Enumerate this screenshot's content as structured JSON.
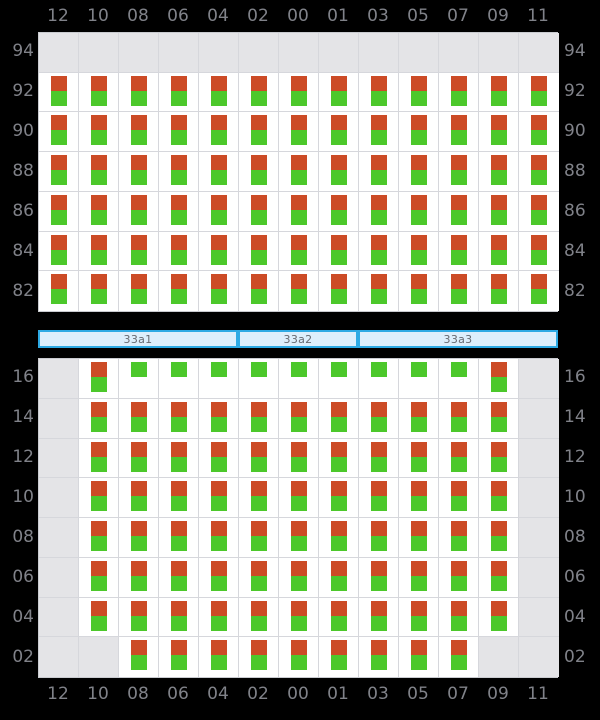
{
  "columns": [
    "12",
    "10",
    "08",
    "06",
    "04",
    "02",
    "00",
    "01",
    "03",
    "05",
    "07",
    "09",
    "11"
  ],
  "colors": {
    "red": "#cc4b26",
    "green": "#4cc82b",
    "empty_cell": "#e4e4e7",
    "cell": "#ffffff",
    "grid_line": "#d6d7dc",
    "band_fill": "#ddeffc",
    "band_border": "#2eaae4",
    "label": "#808289",
    "background": "#000000"
  },
  "top_panel": {
    "row_labels": [
      "94",
      "92",
      "90",
      "88",
      "86",
      "84",
      "82"
    ],
    "rows": [
      {
        "label": "94",
        "cells": [
          "empty",
          "empty",
          "empty",
          "empty",
          "empty",
          "empty",
          "empty",
          "empty",
          "empty",
          "empty",
          "empty",
          "empty",
          "empty"
        ]
      },
      {
        "label": "92",
        "cells": [
          "rg",
          "rg",
          "rg",
          "rg",
          "rg",
          "rg",
          "rg",
          "rg",
          "rg",
          "rg",
          "rg",
          "rg",
          "rg"
        ]
      },
      {
        "label": "90",
        "cells": [
          "rg",
          "rg",
          "rg",
          "rg",
          "rg",
          "rg",
          "rg",
          "rg",
          "rg",
          "rg",
          "rg",
          "rg",
          "rg"
        ]
      },
      {
        "label": "88",
        "cells": [
          "rg",
          "rg",
          "rg",
          "rg",
          "rg",
          "rg",
          "rg",
          "rg",
          "rg",
          "rg",
          "rg",
          "rg",
          "rg"
        ]
      },
      {
        "label": "86",
        "cells": [
          "rg",
          "rg",
          "rg",
          "rg",
          "rg",
          "rg",
          "rg",
          "rg",
          "rg",
          "rg",
          "rg",
          "rg",
          "rg"
        ]
      },
      {
        "label": "84",
        "cells": [
          "rg",
          "rg",
          "rg",
          "rg",
          "rg",
          "rg",
          "rg",
          "rg",
          "rg",
          "rg",
          "rg",
          "rg",
          "rg"
        ]
      },
      {
        "label": "82",
        "cells": [
          "rg",
          "rg",
          "rg",
          "rg",
          "rg",
          "rg",
          "rg",
          "rg",
          "rg",
          "rg",
          "rg",
          "rg",
          "rg"
        ]
      }
    ]
  },
  "band": {
    "segments": [
      {
        "label": "33a1",
        "span": 5
      },
      {
        "label": "33a2",
        "span": 3
      },
      {
        "label": "33a3",
        "span": 5
      }
    ]
  },
  "bottom_panel": {
    "row_labels": [
      "16",
      "14",
      "12",
      "10",
      "08",
      "06",
      "04",
      "02"
    ],
    "rows": [
      {
        "label": "16",
        "cells": [
          "empty",
          "rg",
          "g",
          "g",
          "g",
          "g",
          "g",
          "g",
          "g",
          "g",
          "g",
          "rg",
          "empty"
        ]
      },
      {
        "label": "14",
        "cells": [
          "empty",
          "rg",
          "rg",
          "rg",
          "rg",
          "rg",
          "rg",
          "rg",
          "rg",
          "rg",
          "rg",
          "rg",
          "empty"
        ]
      },
      {
        "label": "12",
        "cells": [
          "empty",
          "rg",
          "rg",
          "rg",
          "rg",
          "rg",
          "rg",
          "rg",
          "rg",
          "rg",
          "rg",
          "rg",
          "empty"
        ]
      },
      {
        "label": "10",
        "cells": [
          "empty",
          "rg",
          "rg",
          "rg",
          "rg",
          "rg",
          "rg",
          "rg",
          "rg",
          "rg",
          "rg",
          "rg",
          "empty"
        ]
      },
      {
        "label": "08",
        "cells": [
          "empty",
          "rg",
          "rg",
          "rg",
          "rg",
          "rg",
          "rg",
          "rg",
          "rg",
          "rg",
          "rg",
          "rg",
          "empty"
        ]
      },
      {
        "label": "06",
        "cells": [
          "empty",
          "rg",
          "rg",
          "rg",
          "rg",
          "rg",
          "rg",
          "rg",
          "rg",
          "rg",
          "rg",
          "rg",
          "empty"
        ]
      },
      {
        "label": "04",
        "cells": [
          "empty",
          "rg",
          "rg",
          "rg",
          "rg",
          "rg",
          "rg",
          "rg",
          "rg",
          "rg",
          "rg",
          "rg",
          "empty"
        ]
      },
      {
        "label": "02",
        "cells": [
          "empty",
          "empty",
          "rg",
          "rg",
          "rg",
          "rg",
          "rg",
          "rg",
          "rg",
          "rg",
          "rg",
          "empty",
          "empty"
        ]
      }
    ]
  },
  "chart_data": {
    "type": "heatmap",
    "title": "",
    "xlabel": "",
    "ylabel": "",
    "x_tick_labels": [
      "12",
      "10",
      "08",
      "06",
      "04",
      "02",
      "00",
      "01",
      "03",
      "05",
      "07",
      "09",
      "11"
    ],
    "panels": [
      {
        "name": "top",
        "y_tick_labels": [
          "94",
          "92",
          "90",
          "88",
          "86",
          "84",
          "82"
        ],
        "marker_types": [
          "red",
          "green"
        ],
        "matrix": [
          [
            "",
            "",
            "",
            "",
            "",
            "",
            "",
            "",
            "",
            "",
            "",
            "",
            ""
          ],
          [
            "rg",
            "rg",
            "rg",
            "rg",
            "rg",
            "rg",
            "rg",
            "rg",
            "rg",
            "rg",
            "rg",
            "rg",
            "rg"
          ],
          [
            "rg",
            "rg",
            "rg",
            "rg",
            "rg",
            "rg",
            "rg",
            "rg",
            "rg",
            "rg",
            "rg",
            "rg",
            "rg"
          ],
          [
            "rg",
            "rg",
            "rg",
            "rg",
            "rg",
            "rg",
            "rg",
            "rg",
            "rg",
            "rg",
            "rg",
            "rg",
            "rg"
          ],
          [
            "rg",
            "rg",
            "rg",
            "rg",
            "rg",
            "rg",
            "rg",
            "rg",
            "rg",
            "rg",
            "rg",
            "rg",
            "rg"
          ],
          [
            "rg",
            "rg",
            "rg",
            "rg",
            "rg",
            "rg",
            "rg",
            "rg",
            "rg",
            "rg",
            "rg",
            "rg",
            "rg"
          ],
          [
            "rg",
            "rg",
            "rg",
            "rg",
            "rg",
            "rg",
            "rg",
            "rg",
            "rg",
            "rg",
            "rg",
            "rg",
            "rg"
          ]
        ]
      },
      {
        "name": "bottom",
        "y_tick_labels": [
          "16",
          "14",
          "12",
          "10",
          "08",
          "06",
          "04",
          "02"
        ],
        "marker_types": [
          "red",
          "green"
        ],
        "matrix": [
          [
            "",
            "rg",
            "g",
            "g",
            "g",
            "g",
            "g",
            "g",
            "g",
            "g",
            "g",
            "rg",
            ""
          ],
          [
            "",
            "rg",
            "rg",
            "rg",
            "rg",
            "rg",
            "rg",
            "rg",
            "rg",
            "rg",
            "rg",
            "rg",
            ""
          ],
          [
            "",
            "rg",
            "rg",
            "rg",
            "rg",
            "rg",
            "rg",
            "rg",
            "rg",
            "rg",
            "rg",
            "rg",
            ""
          ],
          [
            "",
            "rg",
            "rg",
            "rg",
            "rg",
            "rg",
            "rg",
            "rg",
            "rg",
            "rg",
            "rg",
            "rg",
            ""
          ],
          [
            "",
            "rg",
            "rg",
            "rg",
            "rg",
            "rg",
            "rg",
            "rg",
            "rg",
            "rg",
            "rg",
            "rg",
            ""
          ],
          [
            "",
            "rg",
            "rg",
            "rg",
            "rg",
            "rg",
            "rg",
            "rg",
            "rg",
            "rg",
            "rg",
            "rg",
            ""
          ],
          [
            "",
            "rg",
            "rg",
            "rg",
            "rg",
            "rg",
            "rg",
            "rg",
            "rg",
            "rg",
            "rg",
            "rg",
            ""
          ],
          [
            "",
            "",
            "rg",
            "rg",
            "rg",
            "rg",
            "rg",
            "rg",
            "rg",
            "rg",
            "rg",
            "",
            ""
          ]
        ]
      }
    ],
    "group_bands": [
      {
        "label": "33a1",
        "columns": [
          "12",
          "10",
          "08",
          "06",
          "04"
        ]
      },
      {
        "label": "33a2",
        "columns": [
          "02",
          "00",
          "01"
        ]
      },
      {
        "label": "33a3",
        "columns": [
          "03",
          "05",
          "07",
          "09",
          "11"
        ]
      }
    ],
    "grid": true,
    "legend": []
  }
}
